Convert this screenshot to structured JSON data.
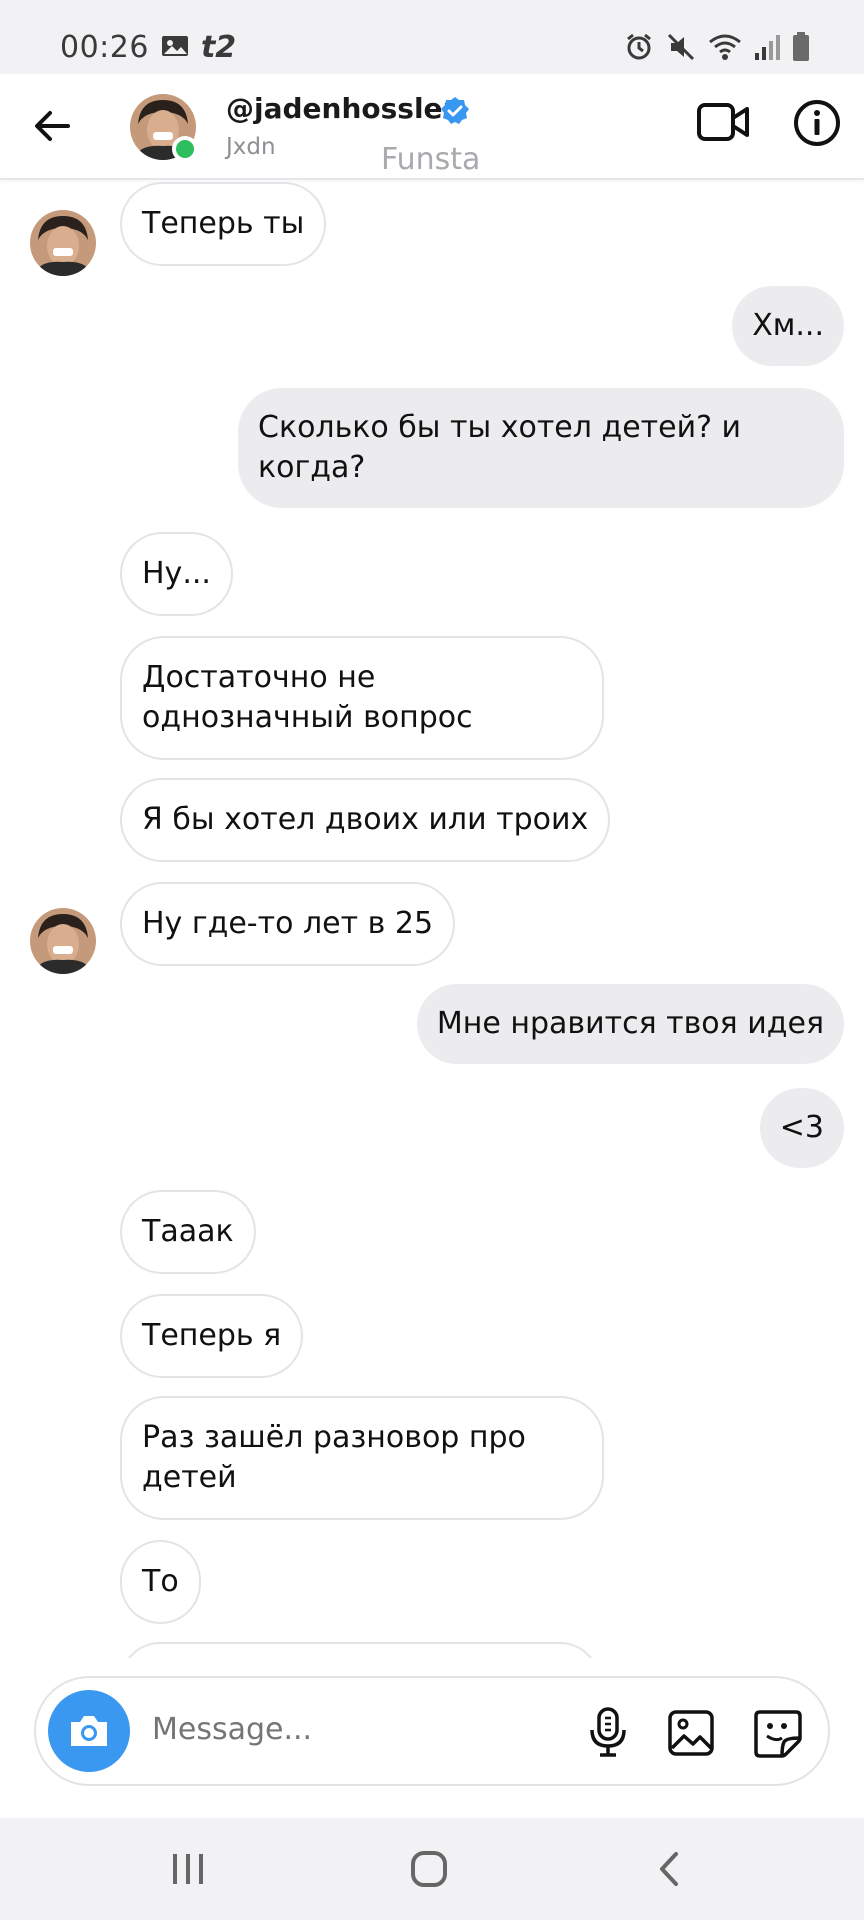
{
  "status_bar": {
    "time": "00:26",
    "carrier": "t2",
    "icons": [
      "image-icon",
      "alarm-icon",
      "mute-icon",
      "wifi-icon",
      "signal-icon",
      "battery-icon"
    ]
  },
  "header": {
    "username": "@jadenhossler",
    "subtitle": "Jxdn",
    "watermark": "Funsta",
    "verified": true,
    "online": true,
    "accent_color": "#3897f0",
    "online_color": "#2dbe60"
  },
  "messages": [
    {
      "side": "in",
      "text": "Теперь ты",
      "avatar": true
    },
    {
      "side": "out",
      "text": "Хм..."
    },
    {
      "side": "out",
      "text": "Сколько бы ты хотел детей?  и когда?"
    },
    {
      "side": "in",
      "text": "Ну..."
    },
    {
      "side": "in",
      "text": "Достаточно не однозначный вопрос"
    },
    {
      "side": "in",
      "text": "Я бы хотел двоих или троих"
    },
    {
      "side": "in",
      "text": "Ну где-то лет в 25",
      "avatar": true
    },
    {
      "side": "out",
      "text": "Мне нравится твоя идея"
    },
    {
      "side": "out",
      "text": "<3"
    },
    {
      "side": "in",
      "text": "Тааак"
    },
    {
      "side": "in",
      "text": "Теперь я"
    },
    {
      "side": "in",
      "text": "Раз зашёл разновор про детей"
    },
    {
      "side": "in",
      "text": "То"
    }
  ],
  "composer": {
    "placeholder": "Message...",
    "camera_color": "#3a98f0"
  },
  "nav": {
    "buttons": [
      "recent-apps-icon",
      "home-icon",
      "back-icon"
    ]
  }
}
